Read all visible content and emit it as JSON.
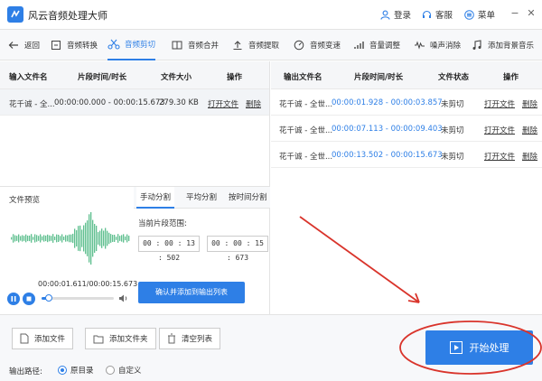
{
  "app": {
    "title": "风云音频处理大师",
    "login": "登录",
    "service": "客服",
    "menu": "菜单"
  },
  "toolbar": {
    "back": "返回",
    "items": [
      "音频转换",
      "音频剪切",
      "音频合并",
      "音频提取",
      "音频变速",
      "音量调整",
      "噪声消除",
      "添加背景音乐"
    ],
    "active_index": 1
  },
  "input_table": {
    "headers": [
      "输入文件名",
      "片段时间/时长",
      "文件大小",
      "操作"
    ],
    "rows": [
      {
        "name": "花千诚 - 全...",
        "time": "00:00:00.000 - 00:00:15.673",
        "size": "279.30 KB",
        "open": "打开文件",
        "delete": "删除"
      }
    ]
  },
  "output_table": {
    "headers": [
      "输出文件名",
      "片段时间/时长",
      "文件状态",
      "操作"
    ],
    "rows": [
      {
        "name": "花千诚 - 全世...",
        "time": "00:00:01.928 - 00:00:03.857",
        "status": "未剪切",
        "open": "打开文件",
        "delete": "删除"
      },
      {
        "name": "花千诚 - 全世...",
        "time": "00:00:07.113 - 00:00:09.403",
        "status": "未剪切",
        "open": "打开文件",
        "delete": "删除"
      },
      {
        "name": "花千诚 - 全世...",
        "time": "00:00:13.502 - 00:00:15.673",
        "status": "未剪切",
        "open": "打开文件",
        "delete": "删除"
      }
    ]
  },
  "preview": {
    "title": "文件预览",
    "tabs": [
      "手动分割",
      "平均分割",
      "按时间分割"
    ],
    "active_tab": 0,
    "range_label": "当前片段范围:",
    "start": "00 : 00 : 13 : 502",
    "end": "00 : 00 : 15 : 673",
    "play_time": "00:00:01.611/00:00:15.673",
    "progress": 0.103,
    "confirm": "确认并添加到输出列表"
  },
  "bottom": {
    "add_file": "添加文件",
    "add_folder": "添加文件夹",
    "clear_list": "清空列表",
    "output_path_label": "输出路径:",
    "option_original": "原目录",
    "option_custom": "自定义",
    "selected_option": "原目录",
    "start": "开始处理"
  },
  "colors": {
    "accent": "#2e7fe6",
    "annotation": "#d9342b",
    "wave": "#5fbf8f"
  }
}
